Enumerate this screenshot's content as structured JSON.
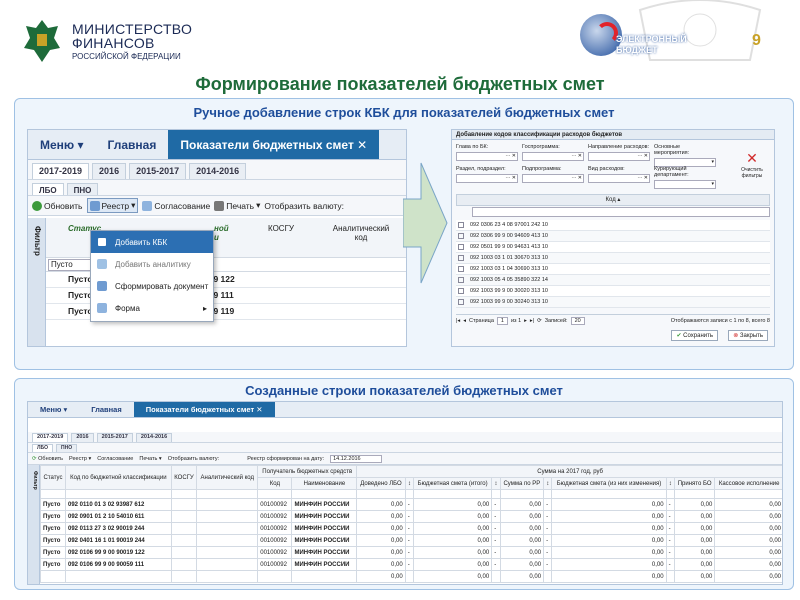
{
  "header": {
    "ministry_line1": "МИНИСТЕРСТВО",
    "ministry_line2": "ФИНАНСОВ",
    "ministry_line3": "РОССИЙСКОЙ ФЕДЕРАЦИИ",
    "eb_line1": "ЭЛЕКТРОННЫЙ",
    "eb_line2": "БЮДЖЕТ",
    "page_number": "9"
  },
  "title": "Формирование показателей бюджетных смет",
  "top_panel": {
    "title": "Ручное добавление строк КБК для показателей бюджетных смет"
  },
  "bottom_panel": {
    "title": "Созданные строки показателей бюджетных смет"
  },
  "app": {
    "tabs": {
      "menu": "Меню",
      "main": "Главная",
      "indicators": "Показатели бюджетных смет",
      "close": "✕"
    },
    "years": [
      "2017-2019",
      "2016",
      "2015-2017",
      "2014-2016"
    ],
    "subtabs": [
      "ЛБО",
      "ПНО"
    ],
    "toolbar": {
      "refresh": "Обновить",
      "registry": "Реестр",
      "agreement": "Согласование",
      "print": "Печать",
      "show_currency": "Отобразить валюту:"
    },
    "filter": "Фильтр",
    "columns": {
      "status": "Статус",
      "kbk": "Код по бюджетной классификации",
      "kosgu": "КОСГУ",
      "analytic": "Аналитический код"
    },
    "filter_value": "Пусто",
    "rows": [
      {
        "status": "Пусто",
        "code": "092 0106 99 9 00 90019 122"
      },
      {
        "status": "Пусто",
        "code": "092 0106 99 9 00 90059 111"
      },
      {
        "status": "Пусто",
        "code": "092 0106 99 9 00 90059 119"
      }
    ],
    "menu": [
      "Добавить КБК",
      "Добавить аналитику",
      "Сформировать документ",
      "Форма"
    ]
  },
  "dialog": {
    "title": "Добавление кодов классификации расходов бюджетов",
    "labels": [
      "Глава по БК:",
      "Госпрограмма:",
      "Направление расходов:",
      "Основные мероприятия:",
      "Раздел, подраздел:",
      "Подпрограмма:",
      "Вид расходов:",
      "Курирующий департамент:"
    ],
    "clear": "Очистить фильтры",
    "code_header": "Код",
    "codes": [
      "092 0306 23 4 08 97001 242 10",
      "092 0306 99 9 00 94609 413 10",
      "092 0501 99 9 00 94631 413 10",
      "092 1003 03 1 01 30670 313 10",
      "092 1003 03 1 04 30690 313 10",
      "092 1003 05 4 05 35890 322 14",
      "092 1003 99 9 00 30020 313 10",
      "092 1003 99 9 00 30240 313 10"
    ],
    "pager": {
      "page_label": "Страница",
      "page": "1",
      "of": "из 1",
      "records_label": "Записей:",
      "records": "20",
      "status": "Отображаются записи с 1 по 8, всего 8"
    },
    "save": "Сохранить",
    "close": "Закрыть"
  },
  "bottom_app": {
    "tabs": {
      "menu": "Меню",
      "main": "Главная",
      "indicators": "Показатели бюджетных смет"
    },
    "years": [
      "2017-2019",
      "2016",
      "2015-2017",
      "2014-2016"
    ],
    "subtabs": [
      "ЛБО",
      "ПНО"
    ],
    "toolbar": {
      "refresh": "Обновить",
      "registry": "Реестр",
      "agreement": "Согласование",
      "print": "Печать",
      "show_currency": "Отобразить валюту:",
      "formed_on": "Реестр сформирован на дату:",
      "date": "14.12.2016"
    },
    "headers": {
      "status": "Статус",
      "kbk": "Код по бюджетной классификации",
      "kosgu": "КОСГУ",
      "analytic": "Аналитический код",
      "recipient": "Получатель бюджетных средств",
      "code": "Код",
      "name": "Наименование",
      "sum_group": "Сумма на 2017 год, руб",
      "lbo": "Доведено ЛБО",
      "smeta_total": "Бюджетная смета (итого)",
      "rr": "Сумма по РР",
      "smeta_changes": "Бюджетная смета (из них изменения)",
      "accepted": "Принято БО",
      "cash": "Кассовое исполнение"
    },
    "rows": [
      {
        "status": "Пусто",
        "kbk": "092 0110 01 3 02 93987 612",
        "code": "00100092",
        "name": "МИНФИН РОССИИ"
      },
      {
        "status": "Пусто",
        "kbk": "092 0901 01 2 10 54010 611",
        "code": "00100092",
        "name": "МИНФИН РОССИИ"
      },
      {
        "status": "Пусто",
        "kbk": "092 0113 27 3 02 90019 244",
        "code": "00100092",
        "name": "МИНФИН РОССИИ"
      },
      {
        "status": "Пусто",
        "kbk": "092 0401 16 1 01 90019 244",
        "code": "00100092",
        "name": "МИНФИН РОССИИ"
      },
      {
        "status": "Пусто",
        "kbk": "092 0106 99 9 00 90019 122",
        "code": "00100092",
        "name": "МИНФИН РОССИИ"
      },
      {
        "status": "Пусто",
        "kbk": "092 0106 99 9 00 90059 111",
        "code": "00100092",
        "name": "МИНФИН РОССИИ"
      }
    ],
    "zero": "0,00",
    "dash": "-"
  }
}
